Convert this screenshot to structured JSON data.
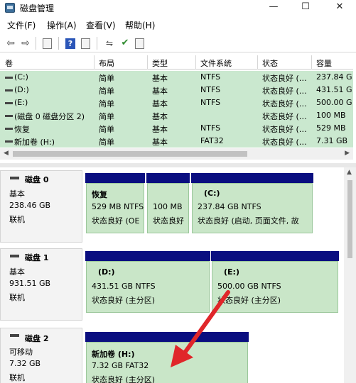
{
  "window": {
    "title": "磁盘管理",
    "minimize": "—",
    "maximize": "☐",
    "close": "✕"
  },
  "menu": {
    "items": [
      "文件(F)",
      "操作(A)",
      "查看(V)",
      "帮助(H)"
    ]
  },
  "toolbar": {
    "back": "⇦",
    "forward": "⇨",
    "help": "?"
  },
  "volume_table": {
    "columns": [
      "卷",
      "布局",
      "类型",
      "文件系统",
      "状态",
      "容量"
    ],
    "rows": [
      {
        "volume": "(C:)",
        "layout": "简单",
        "type": "基本",
        "fs": "NTFS",
        "status": "状态良好 (…",
        "capacity": "237.84 G"
      },
      {
        "volume": "(D:)",
        "layout": "简单",
        "type": "基本",
        "fs": "NTFS",
        "status": "状态良好 (…",
        "capacity": "431.51 G"
      },
      {
        "volume": "(E:)",
        "layout": "简单",
        "type": "基本",
        "fs": "NTFS",
        "status": "状态良好 (…",
        "capacity": "500.00 G"
      },
      {
        "volume": "(磁盘 0 磁盘分区 2)",
        "layout": "简单",
        "type": "基本",
        "fs": "",
        "status": "状态良好 (…",
        "capacity": "100 MB"
      },
      {
        "volume": "恢复",
        "layout": "简单",
        "type": "基本",
        "fs": "NTFS",
        "status": "状态良好 (…",
        "capacity": "529 MB"
      },
      {
        "volume": "新加卷 (H:)",
        "layout": "简单",
        "type": "基本",
        "fs": "FAT32",
        "status": "状态良好 (…",
        "capacity": "7.31 GB"
      }
    ]
  },
  "disks": [
    {
      "name": "磁盘 0",
      "kind": "基本",
      "size": "238.46 GB",
      "state": "联机",
      "partitions": [
        {
          "label": "恢复",
          "info": "529 MB NTFS",
          "status": "状态良好 (OE"
        },
        {
          "label": "",
          "info": "100 MB",
          "status": "状态良好"
        },
        {
          "label": "(C:)",
          "info": "237.84 GB NTFS",
          "status": "状态良好 (启动, 页面文件, 故"
        }
      ]
    },
    {
      "name": "磁盘 1",
      "kind": "基本",
      "size": "931.51 GB",
      "state": "联机",
      "partitions": [
        {
          "label": "(D:)",
          "info": "431.51 GB NTFS",
          "status": "状态良好 (主分区)"
        },
        {
          "label": "(E:)",
          "info": "500.00 GB NTFS",
          "status": "状态良好 (主分区)"
        }
      ]
    },
    {
      "name": "磁盘 2",
      "kind": "可移动",
      "size": "7.32 GB",
      "state": "联机",
      "partitions": [
        {
          "label": "新加卷  (H:)",
          "info": "7.32 GB FAT32",
          "status": "状态良好 (主分区)"
        }
      ]
    }
  ],
  "colors": {
    "partition_header": "#0a0e80",
    "partition_fill": "#c9e6c8",
    "row_highlight": "#cae8cf",
    "annotation_arrow": "#e0262a"
  }
}
